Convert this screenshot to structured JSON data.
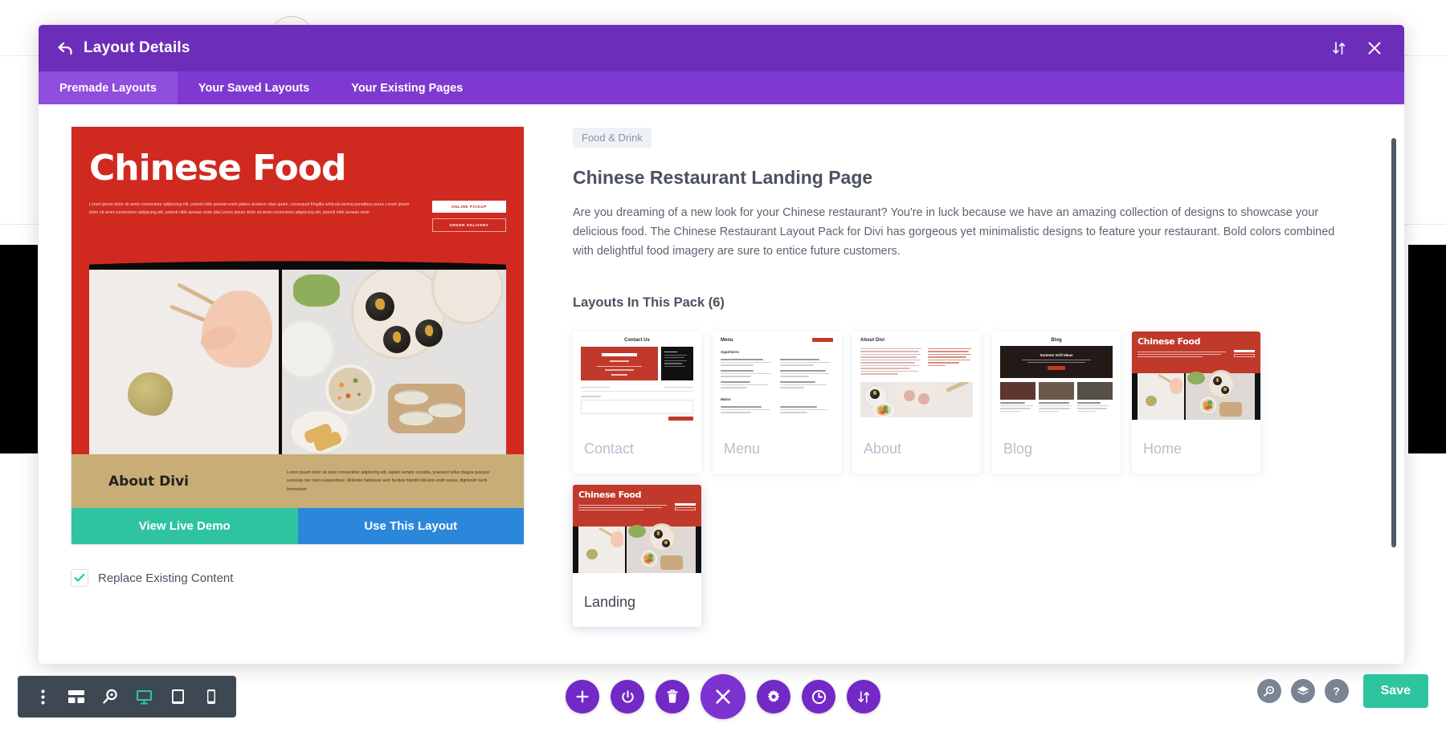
{
  "modal": {
    "title": "Layout Details",
    "back_icon": "back-arrow-icon",
    "sort_icon": "sort-updown-icon",
    "close_icon": "close-x-icon",
    "tabs": [
      {
        "label": "Premade Layouts",
        "active": true
      },
      {
        "label": "Your Saved Layouts",
        "active": false
      },
      {
        "label": "Your Existing Pages",
        "active": false
      }
    ]
  },
  "preview": {
    "hero_title": "Chinese Food",
    "hero_paragraph": "Lorem ipsum dolor sit amet consectetur adipiscing elit, potenti nibh aenean enim platea vivamus vitae quam, consequat fringilla vehicula lacinia penatibus purus Lorem ipsum dolor sit amet consectetur adipiscing elit, potenti nibh aenean enim plat Lorem ipsum dolor sit amet consectetur adipiscing elit, potenti nibh aenean enim",
    "hero_button_primary": "ONLINE PICKUP",
    "hero_button_secondary": "ORDER DELIVERY",
    "about_title": "About Divi",
    "about_paragraph": "Lorem ipsum dolor sit amet consectetur adipiscing elit, sapien tempor conubia, praesent tellus magna quisque sociosqu nec nam suspendisse. Molestie habitasse sem facilisis blandit ridiculus enim varius, dignissim taciti fermentum",
    "view_demo_label": "View Live Demo",
    "use_layout_label": "Use This Layout",
    "replace_label": "Replace Existing Content",
    "replace_checked": true,
    "check_icon": "check-icon"
  },
  "details": {
    "category": "Food & Drink",
    "title": "Chinese Restaurant Landing Page",
    "description": "Are you dreaming of a new look for your Chinese restaurant? You're in luck because we have an amazing collection of designs to showcase your delicious food. The Chinese Restaurant Layout Pack for Divi has gorgeous yet minimalistic designs to feature your restaurant. Bold colors combined with delightful food imagery are sure to entice future customers.",
    "list_heading": "Layouts In This Pack (6)",
    "layouts": [
      {
        "name": "Contact",
        "thumb": "contact",
        "selected": false,
        "thumb_title": "Contact Us"
      },
      {
        "name": "Menu",
        "thumb": "menu",
        "selected": false,
        "thumb_title": "Menu"
      },
      {
        "name": "About",
        "thumb": "about",
        "selected": false,
        "thumb_title": "About Divi"
      },
      {
        "name": "Blog",
        "thumb": "blog",
        "selected": false,
        "thumb_title": "Blog"
      },
      {
        "name": "Home",
        "thumb": "home",
        "selected": false,
        "thumb_title": "Chinese Food"
      },
      {
        "name": "Landing",
        "thumb": "landing",
        "selected": true,
        "thumb_title": "Chinese Food"
      }
    ],
    "menu_thumb": {
      "section_1": "Appetizers",
      "section_2": "Mains"
    },
    "blog_thumb": {
      "hero_title": "Summer Grill Ideas"
    }
  },
  "toolbar": {
    "left_items": [
      {
        "name": "more-options-icon"
      },
      {
        "name": "wireframe-icon"
      },
      {
        "name": "zoom-icon"
      },
      {
        "name": "desktop-icon",
        "active": true
      },
      {
        "name": "tablet-icon"
      },
      {
        "name": "phone-icon"
      }
    ],
    "center_items": [
      {
        "name": "add-icon"
      },
      {
        "name": "power-icon"
      },
      {
        "name": "trash-icon"
      },
      {
        "name": "close-icon",
        "big": true
      },
      {
        "name": "gear-icon"
      },
      {
        "name": "history-icon"
      },
      {
        "name": "sort-icon"
      }
    ],
    "right_items": [
      {
        "name": "search-icon"
      },
      {
        "name": "layers-icon"
      },
      {
        "name": "help-icon",
        "glyph": "?"
      }
    ],
    "save_label": "Save"
  },
  "colors": {
    "header_purple": "#6c2eb9",
    "tabs_purple": "#7e3ad0",
    "tab_active_purple": "#8f4ede",
    "accent_teal": "#2ec4a0",
    "accent_blue": "#2b87da",
    "brand_red": "#d02a20",
    "toolbar_dark": "#3d4853",
    "button_purple": "#7229c6"
  }
}
